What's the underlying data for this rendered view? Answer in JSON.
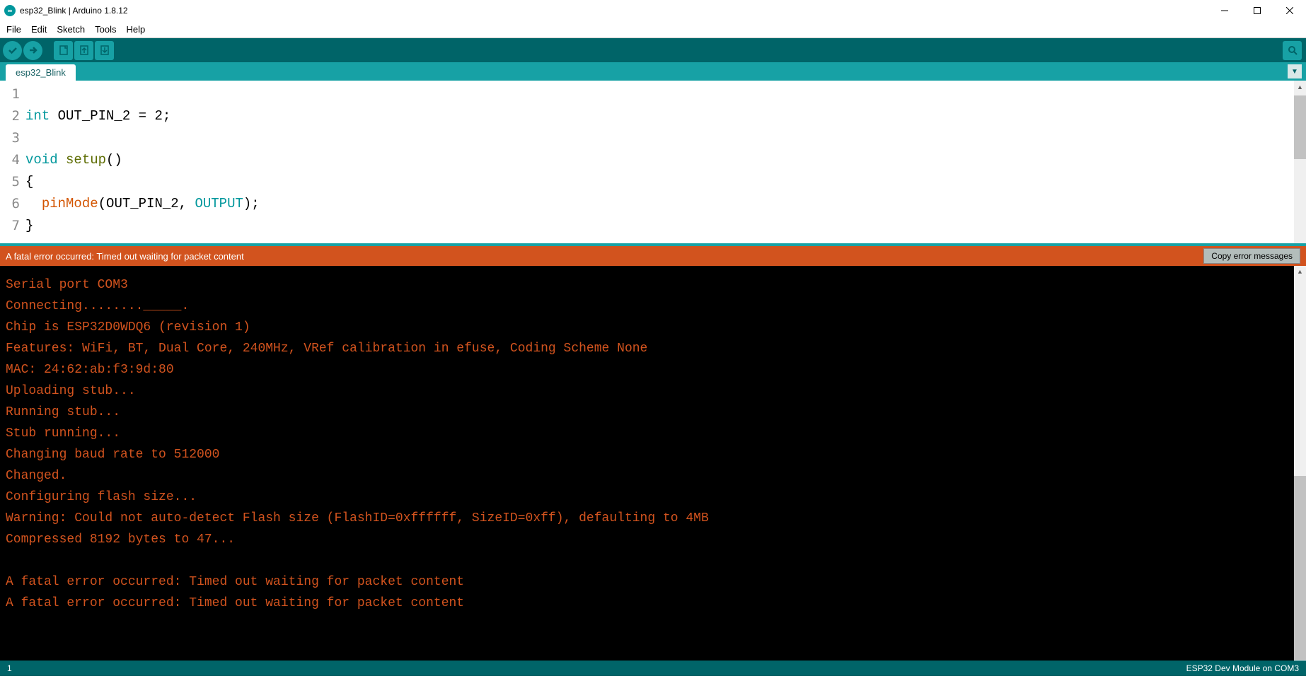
{
  "window": {
    "title": "esp32_Blink | Arduino 1.8.12",
    "app_icon_label": "∞"
  },
  "menu": {
    "items": [
      "File",
      "Edit",
      "Sketch",
      "Tools",
      "Help"
    ]
  },
  "toolbar": {
    "verify_tip": "Verify",
    "upload_tip": "Upload",
    "new_tip": "New",
    "open_tip": "Open",
    "save_tip": "Save",
    "serial_tip": "Serial Monitor"
  },
  "tabs": {
    "active": "esp32_Blink"
  },
  "editor": {
    "line_numbers": [
      "1",
      "2",
      "3",
      "4",
      "5",
      "6",
      "7"
    ],
    "lines": [
      {
        "segments": [
          {
            "t": "",
            "c": ""
          }
        ]
      },
      {
        "segments": [
          {
            "t": "int",
            "c": "kw"
          },
          {
            "t": " OUT_PIN_2 = ",
            "c": ""
          },
          {
            "t": "2",
            "c": "num"
          },
          {
            "t": ";",
            "c": ""
          }
        ]
      },
      {
        "segments": [
          {
            "t": "",
            "c": ""
          }
        ]
      },
      {
        "segments": [
          {
            "t": "void",
            "c": "kw"
          },
          {
            "t": " ",
            "c": ""
          },
          {
            "t": "setup",
            "c": "fnname"
          },
          {
            "t": "()",
            "c": ""
          }
        ]
      },
      {
        "segments": [
          {
            "t": "{",
            "c": ""
          }
        ]
      },
      {
        "segments": [
          {
            "t": "  ",
            "c": ""
          },
          {
            "t": "pinMode",
            "c": "fn"
          },
          {
            "t": "(OUT_PIN_2, ",
            "c": ""
          },
          {
            "t": "OUTPUT",
            "c": "const"
          },
          {
            "t": ");",
            "c": ""
          }
        ]
      },
      {
        "segments": [
          {
            "t": "}",
            "c": ""
          }
        ]
      }
    ]
  },
  "error_bar": {
    "message": "A fatal error occurred: Timed out waiting for packet content",
    "copy_button": "Copy error messages"
  },
  "console": {
    "lines": [
      "Serial port COM3",
      "Connecting........_____.",
      "Chip is ESP32D0WDQ6 (revision 1)",
      "Features: WiFi, BT, Dual Core, 240MHz, VRef calibration in efuse, Coding Scheme None",
      "MAC: 24:62:ab:f3:9d:80",
      "Uploading stub...",
      "Running stub...",
      "Stub running...",
      "Changing baud rate to 512000",
      "Changed.",
      "Configuring flash size...",
      "Warning: Could not auto-detect Flash size (FlashID=0xffffff, SizeID=0xff), defaulting to 4MB",
      "Compressed 8192 bytes to 47...",
      "",
      "A fatal error occurred: Timed out waiting for packet content",
      "A fatal error occurred: Timed out waiting for packet content"
    ]
  },
  "footer": {
    "left": "1",
    "right": "ESP32 Dev Module on COM3"
  }
}
